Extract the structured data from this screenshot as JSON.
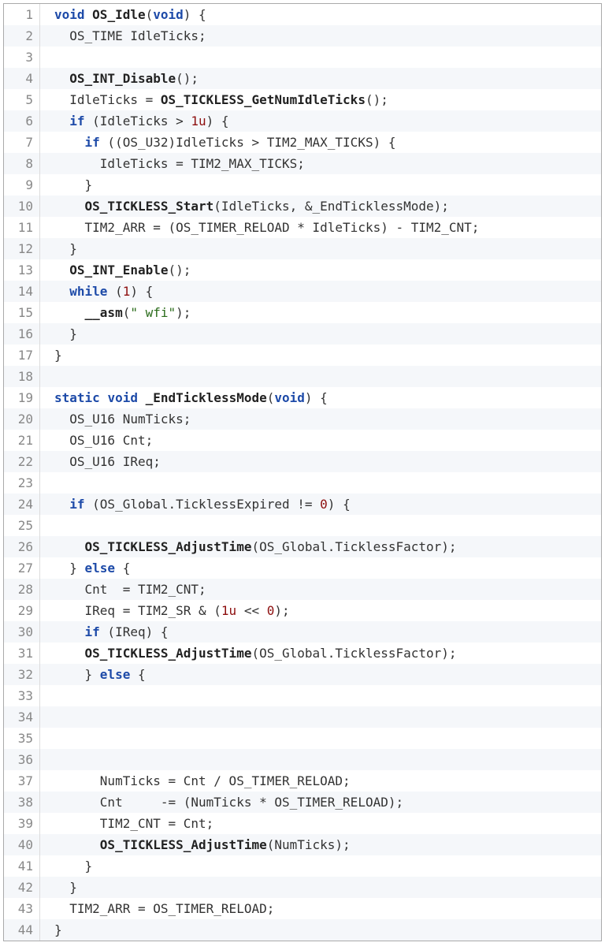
{
  "lines": [
    {
      "n": 1,
      "indent": 0,
      "tokens": [
        {
          "t": "kw",
          "v": "void"
        },
        {
          "t": "sp",
          "v": " "
        },
        {
          "t": "fn",
          "v": "OS_Idle"
        },
        {
          "t": "punc",
          "v": "("
        },
        {
          "t": "kw",
          "v": "void"
        },
        {
          "t": "punc",
          "v": ") {"
        }
      ]
    },
    {
      "n": 2,
      "indent": 1,
      "tokens": [
        {
          "t": "id",
          "v": "OS_TIME IdleTicks;"
        }
      ]
    },
    {
      "n": 3,
      "indent": 0,
      "tokens": []
    },
    {
      "n": 4,
      "indent": 1,
      "tokens": [
        {
          "t": "fn",
          "v": "OS_INT_Disable"
        },
        {
          "t": "punc",
          "v": "();"
        }
      ]
    },
    {
      "n": 5,
      "indent": 1,
      "tokens": [
        {
          "t": "id",
          "v": "IdleTicks = "
        },
        {
          "t": "fn",
          "v": "OS_TICKLESS_GetNumIdleTicks"
        },
        {
          "t": "punc",
          "v": "();"
        }
      ]
    },
    {
      "n": 6,
      "indent": 1,
      "tokens": [
        {
          "t": "kw",
          "v": "if"
        },
        {
          "t": "punc",
          "v": " (IdleTicks > "
        },
        {
          "t": "num",
          "v": "1u"
        },
        {
          "t": "punc",
          "v": ") {"
        }
      ]
    },
    {
      "n": 7,
      "indent": 2,
      "tokens": [
        {
          "t": "kw",
          "v": "if"
        },
        {
          "t": "punc",
          "v": " ((OS_U32)IdleTicks > TIM2_MAX_TICKS) {"
        }
      ]
    },
    {
      "n": 8,
      "indent": 3,
      "tokens": [
        {
          "t": "id",
          "v": "IdleTicks = TIM2_MAX_TICKS;"
        }
      ]
    },
    {
      "n": 9,
      "indent": 2,
      "tokens": [
        {
          "t": "punc",
          "v": "}"
        }
      ]
    },
    {
      "n": 10,
      "indent": 2,
      "tokens": [
        {
          "t": "fn",
          "v": "OS_TICKLESS_Start"
        },
        {
          "t": "punc",
          "v": "(IdleTicks, &_EndTicklessMode);"
        }
      ]
    },
    {
      "n": 11,
      "indent": 2,
      "tokens": [
        {
          "t": "id",
          "v": "TIM2_ARR = (OS_TIMER_RELOAD * IdleTicks) - TIM2_CNT;"
        }
      ]
    },
    {
      "n": 12,
      "indent": 1,
      "tokens": [
        {
          "t": "punc",
          "v": "}"
        }
      ]
    },
    {
      "n": 13,
      "indent": 1,
      "tokens": [
        {
          "t": "fn",
          "v": "OS_INT_Enable"
        },
        {
          "t": "punc",
          "v": "();"
        }
      ]
    },
    {
      "n": 14,
      "indent": 1,
      "tokens": [
        {
          "t": "kw",
          "v": "while"
        },
        {
          "t": "punc",
          "v": " ("
        },
        {
          "t": "num",
          "v": "1"
        },
        {
          "t": "punc",
          "v": ") {"
        }
      ]
    },
    {
      "n": 15,
      "indent": 2,
      "tokens": [
        {
          "t": "fn",
          "v": "__asm"
        },
        {
          "t": "punc",
          "v": "("
        },
        {
          "t": "str",
          "v": "\" wfi\""
        },
        {
          "t": "punc",
          "v": ");"
        }
      ]
    },
    {
      "n": 16,
      "indent": 1,
      "tokens": [
        {
          "t": "punc",
          "v": "}"
        }
      ]
    },
    {
      "n": 17,
      "indent": 0,
      "tokens": [
        {
          "t": "punc",
          "v": "}"
        }
      ]
    },
    {
      "n": 18,
      "indent": 0,
      "tokens": []
    },
    {
      "n": 19,
      "indent": 0,
      "tokens": [
        {
          "t": "kw",
          "v": "static"
        },
        {
          "t": "sp",
          "v": " "
        },
        {
          "t": "kw",
          "v": "void"
        },
        {
          "t": "sp",
          "v": " "
        },
        {
          "t": "fn",
          "v": "_EndTicklessMode"
        },
        {
          "t": "punc",
          "v": "("
        },
        {
          "t": "kw",
          "v": "void"
        },
        {
          "t": "punc",
          "v": ") {"
        }
      ]
    },
    {
      "n": 20,
      "indent": 1,
      "tokens": [
        {
          "t": "id",
          "v": "OS_U16 NumTicks;"
        }
      ]
    },
    {
      "n": 21,
      "indent": 1,
      "tokens": [
        {
          "t": "id",
          "v": "OS_U16 Cnt;"
        }
      ]
    },
    {
      "n": 22,
      "indent": 1,
      "tokens": [
        {
          "t": "id",
          "v": "OS_U16 IReq;"
        }
      ]
    },
    {
      "n": 23,
      "indent": 0,
      "tokens": []
    },
    {
      "n": 24,
      "indent": 1,
      "tokens": [
        {
          "t": "kw",
          "v": "if"
        },
        {
          "t": "punc",
          "v": " (OS_Global.TicklessExpired != "
        },
        {
          "t": "num",
          "v": "0"
        },
        {
          "t": "punc",
          "v": ") {"
        }
      ]
    },
    {
      "n": 25,
      "indent": 0,
      "tokens": []
    },
    {
      "n": 26,
      "indent": 2,
      "tokens": [
        {
          "t": "fn",
          "v": "OS_TICKLESS_AdjustTime"
        },
        {
          "t": "punc",
          "v": "(OS_Global.TicklessFactor);"
        }
      ]
    },
    {
      "n": 27,
      "indent": 1,
      "tokens": [
        {
          "t": "punc",
          "v": "} "
        },
        {
          "t": "kw",
          "v": "else"
        },
        {
          "t": "punc",
          "v": " {"
        }
      ]
    },
    {
      "n": 28,
      "indent": 2,
      "tokens": [
        {
          "t": "id",
          "v": "Cnt  = TIM2_CNT;"
        }
      ]
    },
    {
      "n": 29,
      "indent": 2,
      "tokens": [
        {
          "t": "id",
          "v": "IReq = TIM2_SR & ("
        },
        {
          "t": "num",
          "v": "1u"
        },
        {
          "t": "id",
          "v": " << "
        },
        {
          "t": "num",
          "v": "0"
        },
        {
          "t": "id",
          "v": ");"
        }
      ]
    },
    {
      "n": 30,
      "indent": 2,
      "tokens": [
        {
          "t": "kw",
          "v": "if"
        },
        {
          "t": "punc",
          "v": " (IReq) {"
        }
      ]
    },
    {
      "n": 31,
      "indent": 2,
      "tokens": [
        {
          "t": "fn",
          "v": "OS_TICKLESS_AdjustTime"
        },
        {
          "t": "punc",
          "v": "(OS_Global.TicklessFactor);"
        }
      ]
    },
    {
      "n": 32,
      "indent": 2,
      "tokens": [
        {
          "t": "punc",
          "v": "} "
        },
        {
          "t": "kw",
          "v": "else"
        },
        {
          "t": "punc",
          "v": " {"
        }
      ]
    },
    {
      "n": 33,
      "indent": 0,
      "tokens": []
    },
    {
      "n": 34,
      "indent": 0,
      "tokens": []
    },
    {
      "n": 35,
      "indent": 0,
      "tokens": []
    },
    {
      "n": 36,
      "indent": 0,
      "tokens": []
    },
    {
      "n": 37,
      "indent": 3,
      "tokens": [
        {
          "t": "id",
          "v": "NumTicks = Cnt / OS_TIMER_RELOAD;"
        }
      ]
    },
    {
      "n": 38,
      "indent": 3,
      "tokens": [
        {
          "t": "id",
          "v": "Cnt     -= (NumTicks * OS_TIMER_RELOAD);"
        }
      ]
    },
    {
      "n": 39,
      "indent": 3,
      "tokens": [
        {
          "t": "id",
          "v": "TIM2_CNT = Cnt;"
        }
      ]
    },
    {
      "n": 40,
      "indent": 3,
      "tokens": [
        {
          "t": "fn",
          "v": "OS_TICKLESS_AdjustTime"
        },
        {
          "t": "punc",
          "v": "(NumTicks);"
        }
      ]
    },
    {
      "n": 41,
      "indent": 2,
      "tokens": [
        {
          "t": "punc",
          "v": "}"
        }
      ]
    },
    {
      "n": 42,
      "indent": 1,
      "tokens": [
        {
          "t": "punc",
          "v": "}"
        }
      ]
    },
    {
      "n": 43,
      "indent": 1,
      "tokens": [
        {
          "t": "id",
          "v": "TIM2_ARR = OS_TIMER_RELOAD;"
        }
      ]
    },
    {
      "n": 44,
      "indent": 0,
      "tokens": [
        {
          "t": "punc",
          "v": "}"
        }
      ]
    }
  ]
}
